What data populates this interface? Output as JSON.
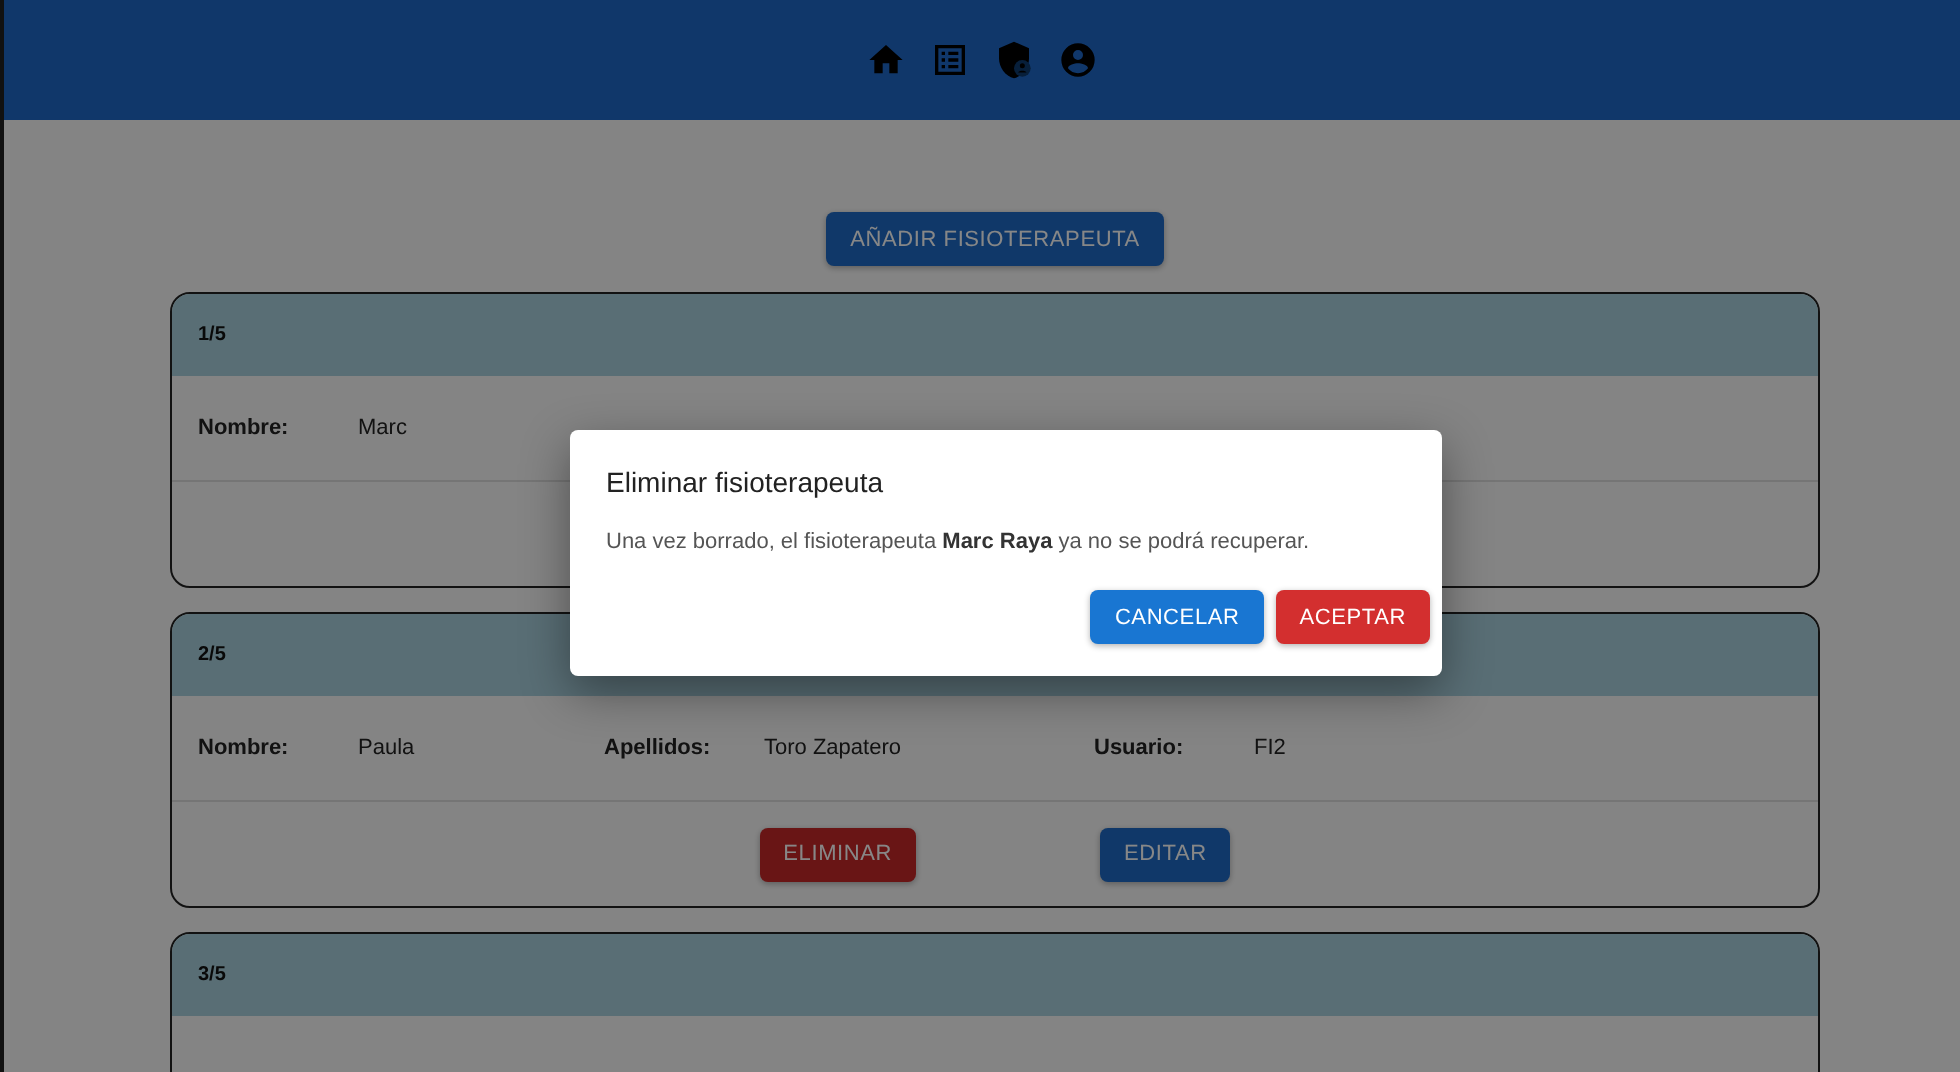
{
  "add_button": "AÑADIR FISIOTERAPEUTA",
  "cards": [
    {
      "index": "1/5",
      "fields": [
        {
          "label": "Nombre:",
          "value": "Marc"
        }
      ]
    },
    {
      "index": "2/5",
      "fields": [
        {
          "label": "Nombre:",
          "value": "Paula"
        },
        {
          "label": "Apellidos:",
          "value": "Toro Zapatero"
        },
        {
          "label": "Usuario:",
          "value": "FI2"
        }
      ],
      "actions": [
        {
          "label": "ELIMINAR",
          "kind": "danger"
        },
        {
          "label": "EDITAR",
          "kind": "primary"
        }
      ]
    },
    {
      "index": "3/5"
    }
  ],
  "dialog": {
    "title": "Eliminar fisioterapeuta",
    "message": "Una vez borrado, el fisioterapeuta **Marc Raya** ya no se podrá recuperar.",
    "actions": [
      {
        "label": "CANCELAR",
        "kind": "primary"
      },
      {
        "label": "ACEPTAR",
        "kind": "danger"
      }
    ]
  }
}
